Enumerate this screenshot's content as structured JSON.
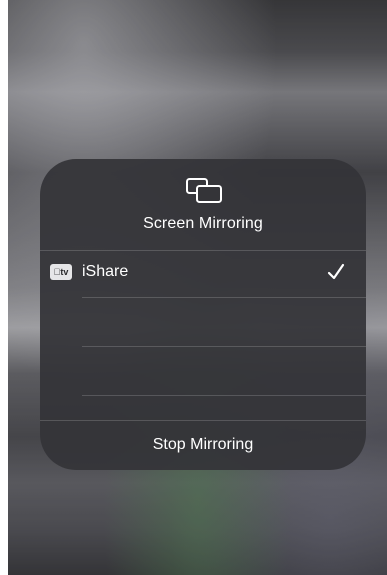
{
  "panel": {
    "title": "Screen Mirroring",
    "icon": "screen-mirroring-icon"
  },
  "devices": [
    {
      "badge": "tv",
      "badge_icon": "apple-tv-icon",
      "name": "iShare",
      "selected": true,
      "check_icon": "checkmark-icon"
    }
  ],
  "footer": {
    "stop_label": "Stop Mirroring"
  }
}
